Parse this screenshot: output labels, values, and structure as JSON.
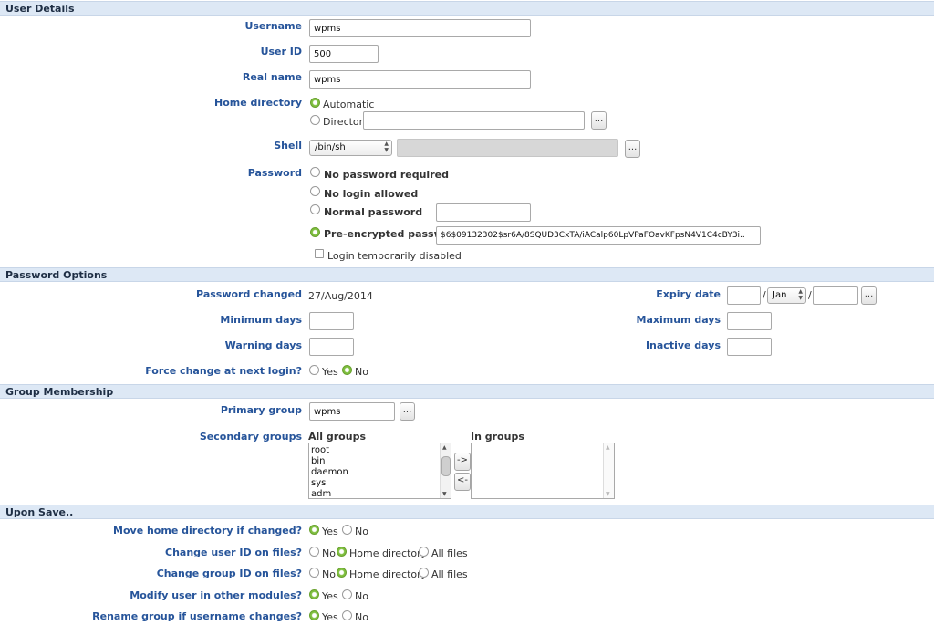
{
  "sections": {
    "user_details": "User Details",
    "password_options": "Password Options",
    "group_membership": "Group Membership",
    "upon_save": "Upon Save.."
  },
  "user": {
    "username_label": "Username",
    "username": "wpms",
    "uid_label": "User ID",
    "uid": "500",
    "realname_label": "Real name",
    "realname": "wpms",
    "home_label": "Home directory",
    "home_auto": "Automatic",
    "home_dir": "Directory",
    "home_dir_value": "",
    "shell_label": "Shell",
    "shell": "/bin/sh",
    "shell_other": "",
    "password_label": "Password",
    "pw_none": "No password required",
    "pw_nologin": "No login allowed",
    "pw_normal": "Normal password",
    "pw_normal_value": "",
    "pw_pre": "Pre-encrypted password",
    "pw_pre_value": "$6$09132302$sr6A/8SQUD3CxTA/iACalp60LpVPaFOavKFpsN4V1C4cBY3i..",
    "login_disabled": "Login temporarily disabled"
  },
  "pwopts": {
    "changed_label": "Password changed",
    "changed_value": "27/Aug/2014",
    "expiry_label": "Expiry date",
    "expiry_day": "",
    "expiry_month": "Jan",
    "expiry_year": "",
    "min_label": "Minimum days",
    "min_value": "",
    "max_label": "Maximum days",
    "max_value": "",
    "warn_label": "Warning days",
    "warn_value": "",
    "inactive_label": "Inactive days",
    "inactive_value": "",
    "force_label": "Force change at next login?",
    "yes": "Yes",
    "no": "No"
  },
  "groups": {
    "primary_label": "Primary group",
    "primary": "wpms",
    "secondary_label": "Secondary groups",
    "all_label": "All groups",
    "in_label": "In groups",
    "all": [
      "root",
      "bin",
      "daemon",
      "sys",
      "adm"
    ],
    "add": "->",
    "remove": "<-"
  },
  "save": {
    "move_label": "Move home directory if changed?",
    "uid_label": "Change user ID on files?",
    "gid_label": "Change group ID on files?",
    "modify_label": "Modify user in other modules?",
    "rename_label": "Rename group if username changes?",
    "yes": "Yes",
    "no": "No",
    "home_directory": "Home directory",
    "all_files": "All files"
  },
  "browse_label": "..."
}
